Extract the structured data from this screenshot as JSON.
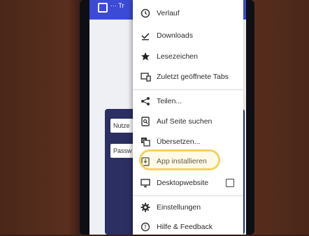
{
  "appbar": {
    "title": "··· Tr"
  },
  "login": {
    "username_placeholder": "Nutze",
    "password_placeholder": "Passw"
  },
  "menu": {
    "items": [
      {
        "label": "Verlauf",
        "icon": "history-icon"
      },
      {
        "label": "Downloads",
        "icon": "download-icon"
      },
      {
        "label": "Lesezeichen",
        "icon": "star-icon"
      },
      {
        "label": "Zuletzt geöffnete Tabs",
        "icon": "recent-tabs-icon"
      },
      {
        "label": "Teilen...",
        "icon": "share-icon"
      },
      {
        "label": "Auf Seite suchen",
        "icon": "find-in-page-icon"
      },
      {
        "label": "Übersetzen...",
        "icon": "translate-icon"
      },
      {
        "label": "App installieren",
        "icon": "install-app-icon"
      },
      {
        "label": "Desktopwebsite",
        "icon": "desktop-icon",
        "checked": false
      },
      {
        "label": "Einstellungen",
        "icon": "gear-icon"
      },
      {
        "label": "Hilfe & Feedback",
        "icon": "help-icon"
      }
    ]
  },
  "colors": {
    "appbar": "#3c4bd6",
    "highlight": "#f4d25c",
    "login_card": "#2b2f62"
  }
}
